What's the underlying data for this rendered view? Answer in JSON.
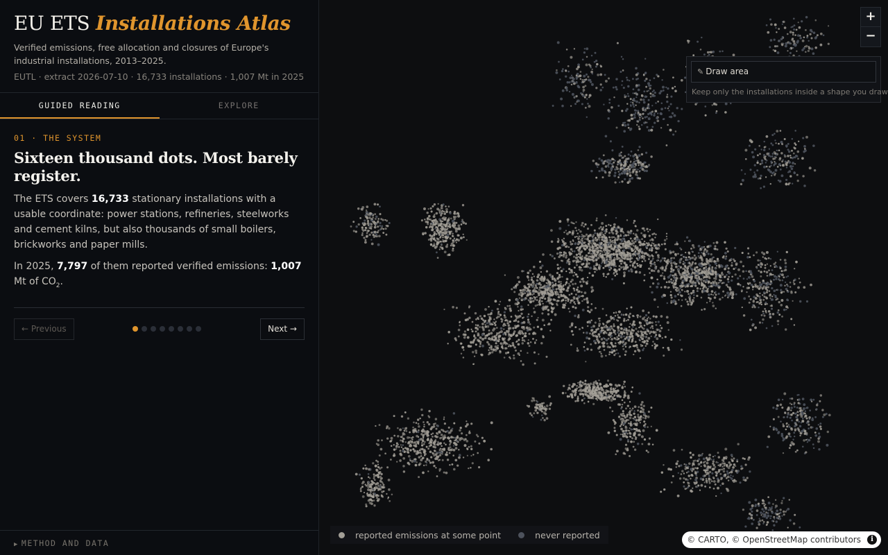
{
  "header": {
    "title_plain": "EU ETS",
    "title_accent": "Installations Atlas",
    "subtitle": "Verified emissions, free allocation and closures of Europe's industrial installations, 2013–2025.",
    "meta": "EUTL · extract 2026-07-10 · 16,733 installations · 1,007 Mt in 2025"
  },
  "tabs": [
    {
      "label": "GUIDED READING",
      "active": true
    },
    {
      "label": "EXPLORE",
      "active": false
    }
  ],
  "story": {
    "kicker": "01 · THE SYSTEM",
    "heading": "Sixteen thousand dots. Most barely register.",
    "p1": {
      "before": "The ETS covers ",
      "count": "16,733",
      "after": " stationary installations with a usable coordinate: power stations, refineries, steelworks and cement kilns, but also thousands of small boilers, brickworks and paper mills."
    },
    "p2": {
      "before": "In 2025, ",
      "reported": "7,797",
      "middle": " of them reported verified emissions: ",
      "total": "1,007",
      "unit": " Mt of CO",
      "sub": "2",
      "end": "."
    },
    "pager": {
      "prev_label": "← Previous",
      "next_label": "Next →",
      "step_count": 8,
      "current_step": 1
    }
  },
  "footer": {
    "method_label": "METHOD AND DATA"
  },
  "map": {
    "zoom_in_label": "+",
    "zoom_out_label": "−",
    "draw_label": "Draw area",
    "draw_icon": "pencil-icon",
    "draw_hint": "Keep only the installations inside a shape you draw.",
    "legend": [
      {
        "label": "reported emissions at some point",
        "color": "#a29e96"
      },
      {
        "label": "never reported",
        "color": "#4d525c"
      }
    ],
    "attribution": "© CARTO, © OpenStreetMap contributors",
    "colors": {
      "reported": "#a29e96",
      "never_reported": "#4d525c",
      "accent": "#e0952d",
      "background": "#0d0e10"
    }
  }
}
